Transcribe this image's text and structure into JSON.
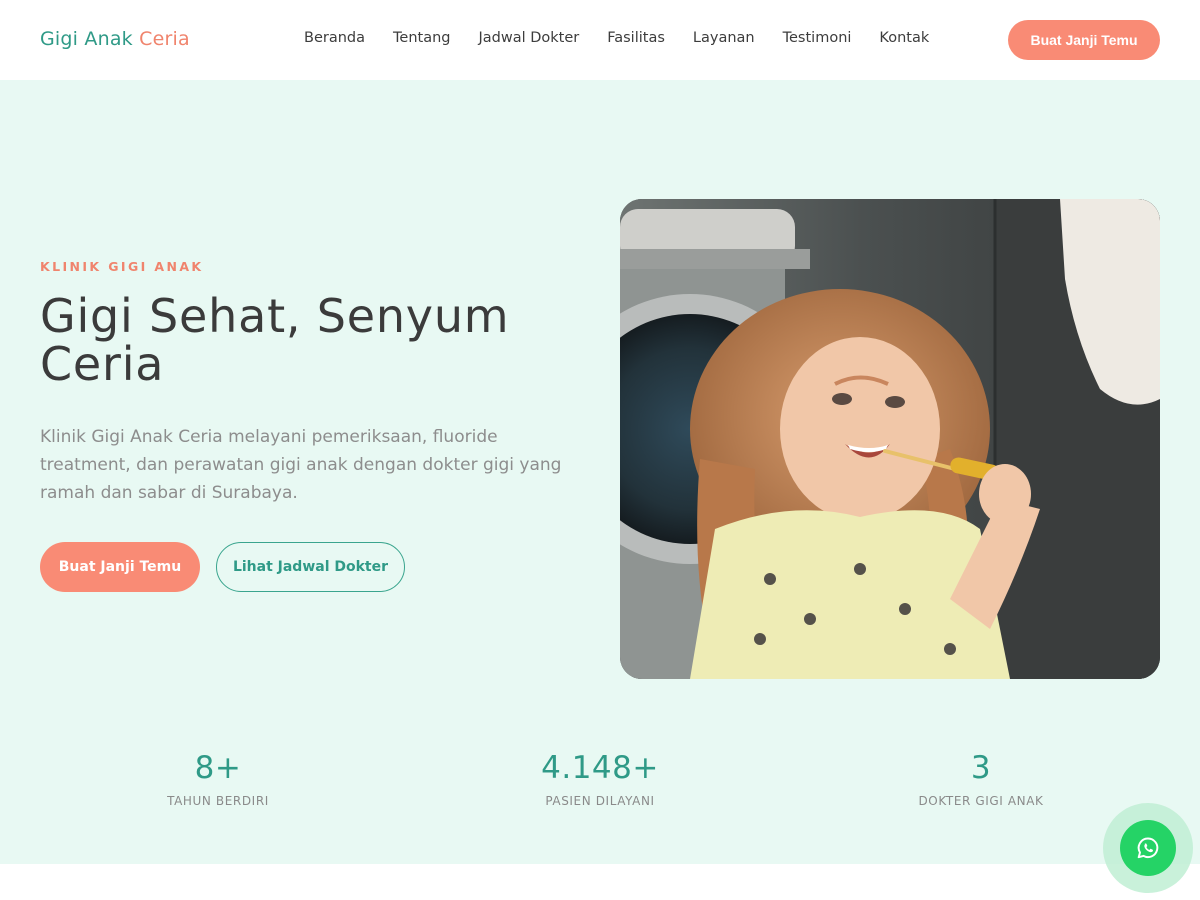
{
  "brand": {
    "part1": "Gigi Anak",
    "part2": "Ceria"
  },
  "nav": {
    "items": [
      {
        "label": "Beranda"
      },
      {
        "label": "Tentang"
      },
      {
        "label": "Jadwal Dokter"
      },
      {
        "label": "Fasilitas"
      },
      {
        "label": "Layanan"
      },
      {
        "label": "Testimoni"
      },
      {
        "label": "Kontak"
      }
    ],
    "cta_label": "Buat Janji Temu"
  },
  "hero": {
    "eyebrow": "KLINIK GIGI ANAK",
    "title": "Gigi Sehat, Senyum Ceria",
    "description": "Klinik Gigi Anak Ceria melayani pemeriksaan, fluoride treatment, dan perawatan gigi anak dengan dokter gigi yang ramah dan sabar di Surabaya.",
    "primary_button": "Buat Janji Temu",
    "secondary_button": "Lihat Jadwal Dokter",
    "image_icon": "child-brushing-teeth-photo"
  },
  "stats": [
    {
      "value": "8+",
      "label": "TAHUN BERDIRI"
    },
    {
      "value": "4.148+",
      "label": "PASIEN DILAYANI"
    },
    {
      "value": "3",
      "label": "DOKTER GIGI ANAK"
    }
  ],
  "floating": {
    "icon": "whatsapp-icon"
  },
  "colors": {
    "brand_green": "#2f9a87",
    "accent_coral": "#f98b75",
    "hero_background": "#e8f9f3",
    "whatsapp_green": "#25d366"
  }
}
